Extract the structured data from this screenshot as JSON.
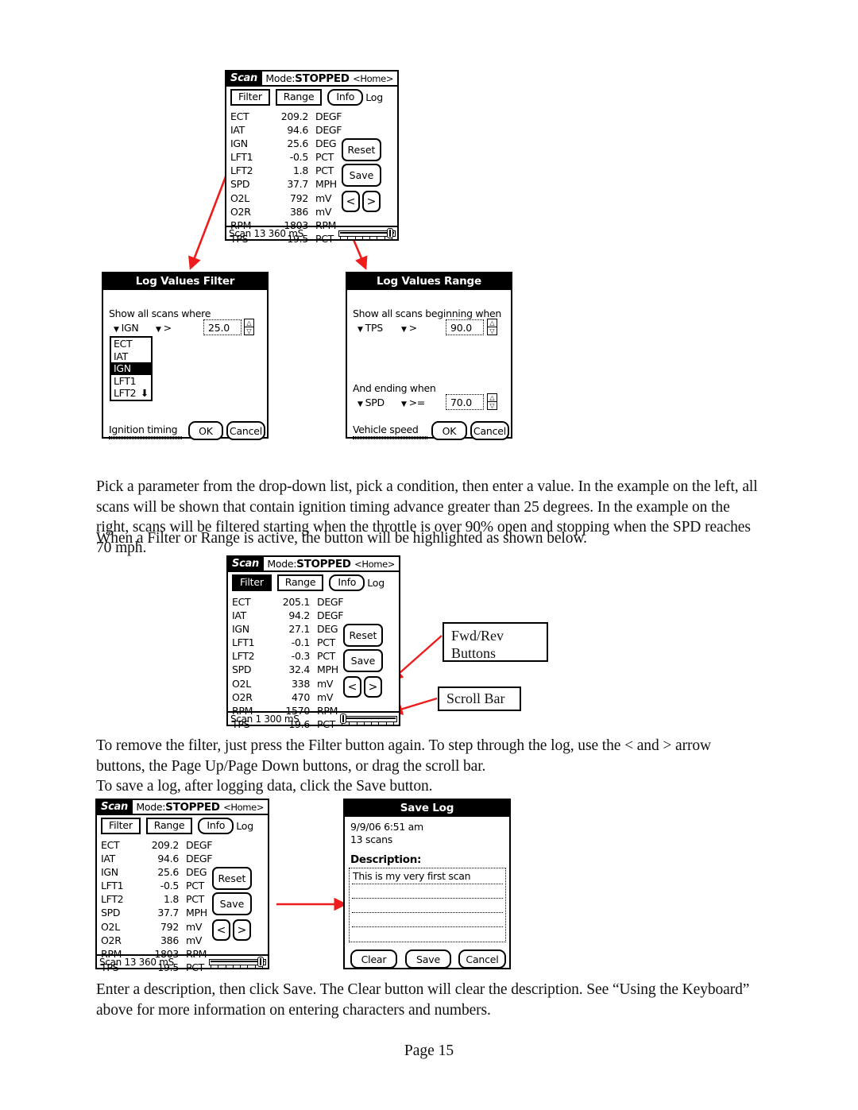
{
  "page": {
    "number_label": "Page 15"
  },
  "paragraphs": {
    "p1": "Pick a parameter from the drop-down list, pick a condition, then enter a value.  In the example on the left, all scans will be shown that contain ignition timing advance greater than 25 degrees.  In the example on the right, scans will be filtered starting when the throttle is over 90% open and stopping when the SPD reaches 70 mph.",
    "p2": "When a Filter or Range is active, the button will be highlighted as shown below.",
    "p3": "To remove the filter, just press the Filter button again.  To step through the log, use the < and > arrow buttons, the Page Up/Page Down buttons, or drag the scroll bar.",
    "p4": "To save a log, after logging data, click the Save button.",
    "p5": "Enter a description, then click Save.  The Clear button will clear the description.  See “Using the Keyboard” above for more information on entering characters and numbers."
  },
  "scan_screen_1": {
    "tab_label": "Scan",
    "mode_prefix": "Mode:",
    "mode_value": "STOPPED",
    "home_label": "<Home>",
    "buttons": {
      "filter": "Filter",
      "range": "Range",
      "info": "Info",
      "log": "Log",
      "reset": "Reset",
      "save": "Save",
      "prev": "<",
      "next": ">"
    },
    "filter_active": false,
    "rows": [
      {
        "name": "ECT",
        "value": "209.2",
        "unit": "DEGF"
      },
      {
        "name": "IAT",
        "value": "94.6",
        "unit": "DEGF"
      },
      {
        "name": "IGN",
        "value": "25.6",
        "unit": "DEG"
      },
      {
        "name": "LFT1",
        "value": "-0.5",
        "unit": "PCT"
      },
      {
        "name": "LFT2",
        "value": "1.8",
        "unit": "PCT"
      },
      {
        "name": "SPD",
        "value": "37.7",
        "unit": "MPH"
      },
      {
        "name": "O2L",
        "value": "792",
        "unit": "mV"
      },
      {
        "name": "O2R",
        "value": "386",
        "unit": "mV"
      },
      {
        "name": "RPM",
        "value": "1803",
        "unit": "RPM"
      },
      {
        "name": "TPS",
        "value": "19.5",
        "unit": "PCT"
      }
    ],
    "footer": "Scan  13 360 mS",
    "scroll_position": "right"
  },
  "scan_screen_2": {
    "tab_label": "Scan",
    "mode_prefix": "Mode:",
    "mode_value": "STOPPED",
    "home_label": "<Home>",
    "buttons": {
      "filter": "Filter",
      "range": "Range",
      "info": "Info",
      "log": "Log",
      "reset": "Reset",
      "save": "Save",
      "prev": "<",
      "next": ">"
    },
    "filter_active": true,
    "rows": [
      {
        "name": "ECT",
        "value": "205.1",
        "unit": "DEGF"
      },
      {
        "name": "IAT",
        "value": "94.2",
        "unit": "DEGF"
      },
      {
        "name": "IGN",
        "value": "27.1",
        "unit": "DEG"
      },
      {
        "name": "LFT1",
        "value": "-0.1",
        "unit": "PCT"
      },
      {
        "name": "LFT2",
        "value": "-0.3",
        "unit": "PCT"
      },
      {
        "name": "SPD",
        "value": "32.4",
        "unit": "MPH"
      },
      {
        "name": "O2L",
        "value": "338",
        "unit": "mV"
      },
      {
        "name": "O2R",
        "value": "470",
        "unit": "mV"
      },
      {
        "name": "RPM",
        "value": "1570",
        "unit": "RPM"
      },
      {
        "name": "TPS",
        "value": "19.6",
        "unit": "PCT"
      }
    ],
    "footer": "Scan  1 300 mS",
    "scroll_position": "left"
  },
  "scan_screen_3": {
    "tab_label": "Scan",
    "mode_prefix": "Mode:",
    "mode_value": "STOPPED",
    "home_label": "<Home>",
    "buttons": {
      "filter": "Filter",
      "range": "Range",
      "info": "Info",
      "log": "Log",
      "reset": "Reset",
      "save": "Save",
      "prev": "<",
      "next": ">"
    },
    "filter_active": false,
    "rows": [
      {
        "name": "ECT",
        "value": "209.2",
        "unit": "DEGF"
      },
      {
        "name": "IAT",
        "value": "94.6",
        "unit": "DEGF"
      },
      {
        "name": "IGN",
        "value": "25.6",
        "unit": "DEG"
      },
      {
        "name": "LFT1",
        "value": "-0.5",
        "unit": "PCT"
      },
      {
        "name": "LFT2",
        "value": "1.8",
        "unit": "PCT"
      },
      {
        "name": "SPD",
        "value": "37.7",
        "unit": "MPH"
      },
      {
        "name": "O2L",
        "value": "792",
        "unit": "mV"
      },
      {
        "name": "O2R",
        "value": "386",
        "unit": "mV"
      },
      {
        "name": "RPM",
        "value": "1803",
        "unit": "RPM"
      },
      {
        "name": "TPS",
        "value": "19.5",
        "unit": "PCT"
      }
    ],
    "footer": "Scan  13 360 mS",
    "scroll_position": "right"
  },
  "filter_dialog": {
    "title": "Log Values Filter",
    "prompt": "Show all scans where",
    "param": "IGN",
    "condition": ">",
    "value": "25.0",
    "list_items": [
      "ECT",
      "IAT",
      "IGN",
      "LFT1",
      "LFT2"
    ],
    "selected_item": "IGN",
    "help_text": "Ignition timing",
    "ok_label": "OK",
    "cancel_label": "Cancel"
  },
  "range_dialog": {
    "title": "Log Values Range",
    "begin_prompt": "Show all scans beginning when",
    "begin_param": "TPS",
    "begin_condition": ">",
    "begin_value": "90.0",
    "end_prompt": "And ending when",
    "end_param": "SPD",
    "end_condition": ">=",
    "end_value": "70.0",
    "help_text": "Vehicle speed",
    "ok_label": "OK",
    "cancel_label": "Cancel"
  },
  "save_log_dialog": {
    "title": "Save Log",
    "timestamp": "9/9/06 6:51 am",
    "scan_count": "13 scans",
    "description_label": "Description:",
    "description_value": "This is my very first scan",
    "clear_label": "Clear",
    "save_label": "Save",
    "cancel_label": "Cancel"
  },
  "callouts": {
    "fwd_rev": "Fwd/Rev\nButtons",
    "fwd_rev_line1": "Fwd/Rev",
    "fwd_rev_line2": "Buttons",
    "scroll_bar": "Scroll Bar"
  },
  "colors": {
    "arrow_red": "#ee1c1c",
    "ink": "#000000",
    "paper": "#ffffff"
  }
}
